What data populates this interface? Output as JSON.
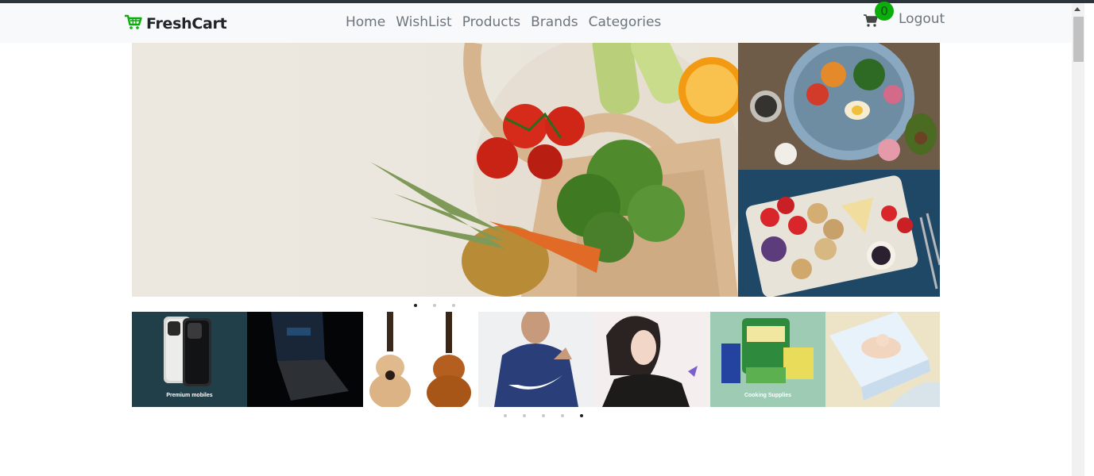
{
  "brand": {
    "name": "FreshCart",
    "icon": "shopping-cart-icon",
    "color": "#0aad0a"
  },
  "nav": {
    "links": [
      "Home",
      "WishList",
      "Products",
      "Brands",
      "Categories"
    ]
  },
  "cart": {
    "icon": "cart-icon",
    "count": "0"
  },
  "logout_label": "Logout",
  "main_slider": {
    "active_index": 0,
    "dot_count": 3
  },
  "category_slider": {
    "active_index": 4,
    "dot_count": 5,
    "tiles": [
      {
        "name": "premium-mobiles",
        "label": "Premium mobiles"
      },
      {
        "name": "laptop",
        "label": ""
      },
      {
        "name": "guitars",
        "label": ""
      },
      {
        "name": "nike-hoodie",
        "label": ""
      },
      {
        "name": "girl-portrait",
        "label": ""
      },
      {
        "name": "cooking-supplies",
        "label": "Cooking Supplies"
      },
      {
        "name": "baby-diapers",
        "label": ""
      }
    ]
  }
}
